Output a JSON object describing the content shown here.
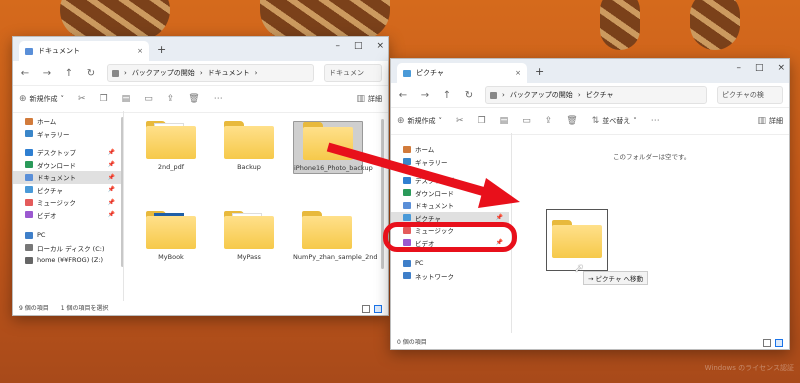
{
  "left_window": {
    "tab_title": "ドキュメント",
    "new_tab": "+",
    "controls": {
      "minimize": "–",
      "maximize": "□",
      "close": "×"
    },
    "address": {
      "crumbs": [
        "バックアップの開始",
        "ドキュメント"
      ],
      "search_placeholder": "ドキュメン"
    },
    "toolbar": {
      "new_label": "新規作成",
      "details_label": "詳細"
    },
    "nav": [
      {
        "label": "ホーム",
        "icon": "home-icon",
        "pinned": false,
        "selected": false
      },
      {
        "label": "ギャラリー",
        "icon": "gallery-icon",
        "pinned": false,
        "selected": false
      },
      {
        "label": "デスクトップ",
        "icon": "desktop-icon",
        "pinned": true,
        "selected": false
      },
      {
        "label": "ダウンロード",
        "icon": "download-icon",
        "pinned": true,
        "selected": false
      },
      {
        "label": "ドキュメント",
        "icon": "documents-icon",
        "pinned": true,
        "selected": true
      },
      {
        "label": "ピクチャ",
        "icon": "pictures-icon",
        "pinned": true,
        "selected": false
      },
      {
        "label": "ミュージック",
        "icon": "music-icon",
        "pinned": true,
        "selected": false
      },
      {
        "label": "ビデオ",
        "icon": "video-icon",
        "pinned": true,
        "selected": false
      },
      {
        "label": "PC",
        "icon": "pc-icon",
        "pinned": false,
        "selected": false
      },
      {
        "label": "ローカル ディスク (C:)",
        "icon": "disk-icon",
        "pinned": false,
        "selected": false
      },
      {
        "label": "home (¥¥FROG) (Z:)",
        "icon": "network-drive-icon",
        "pinned": false,
        "selected": false
      }
    ],
    "files": [
      {
        "name": "2nd_pdf",
        "type": "folder-doc"
      },
      {
        "name": "Backup",
        "type": "folder"
      },
      {
        "name": "iPhone16_Photo_backup",
        "type": "folder",
        "highlighted": true
      },
      {
        "name": "MyBook",
        "type": "folder-book"
      },
      {
        "name": "MyPass",
        "type": "folder-doc"
      },
      {
        "name": "NumPy_zhan_sample_2nd",
        "type": "folder"
      }
    ],
    "status_count": "9 個の項目",
    "status_selected": "1 個の項目を選択"
  },
  "right_window": {
    "tab_title": "ピクチャ",
    "new_tab": "+",
    "controls": {
      "minimize": "–",
      "maximize": "□",
      "close": "×"
    },
    "address": {
      "crumbs": [
        "バックアップの開始",
        "ピクチャ"
      ],
      "search_placeholder": "ピクチャの検"
    },
    "toolbar": {
      "new_label": "新規作成",
      "sort_label": "並べ替え",
      "details_label": "詳細"
    },
    "nav": [
      {
        "label": "ホーム",
        "icon": "home-icon",
        "pinned": false,
        "selected": false
      },
      {
        "label": "ギャラリー",
        "icon": "gallery-icon",
        "pinned": false,
        "selected": false
      },
      {
        "label": "デスクトップ",
        "icon": "desktop-icon",
        "pinned": false,
        "selected": false
      },
      {
        "label": "ダウンロード",
        "icon": "download-icon",
        "pinned": false,
        "selected": false
      },
      {
        "label": "ドキュメント",
        "icon": "documents-icon",
        "pinned": false,
        "selected": false
      },
      {
        "label": "ピクチャ",
        "icon": "pictures-icon",
        "pinned": true,
        "selected": true
      },
      {
        "label": "ミュージック",
        "icon": "music-icon",
        "pinned": false,
        "selected": false
      },
      {
        "label": "ビデオ",
        "icon": "video-icon",
        "pinned": true,
        "selected": false
      },
      {
        "label": "PC",
        "icon": "pc-icon",
        "pinned": false,
        "selected": false
      },
      {
        "label": "ネットワーク",
        "icon": "network-icon",
        "pinned": false,
        "selected": false
      }
    ],
    "empty_message": "このフォルダーは空です。",
    "drag_tooltip": "→ ピクチャ へ移動",
    "status_count": "0 個の項目"
  },
  "annotations": {
    "arrow_color": "#e8101b",
    "highlight_color": "#e8101b"
  },
  "watermark": "Windows のライセンス認証"
}
